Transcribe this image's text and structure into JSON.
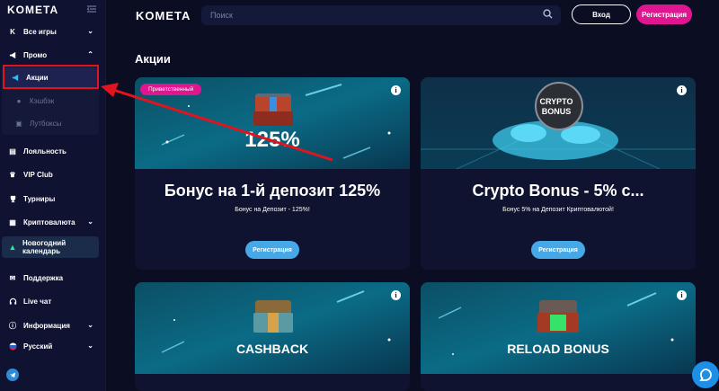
{
  "brand": {
    "logo": "KOMETA"
  },
  "sidebar": {
    "items": [
      {
        "label": "Все игры",
        "icon": "kometa-icon"
      },
      {
        "label": "Промо",
        "icon": "megaphone-icon"
      },
      {
        "label": "Лояльность",
        "icon": "loyalty-icon"
      },
      {
        "label": "VIP Club",
        "icon": "crown-icon"
      },
      {
        "label": "Турниры",
        "icon": "trophy-icon"
      },
      {
        "label": "Криптовалюта",
        "icon": "crypto-icon"
      },
      {
        "label": "Новогодний календарь",
        "icon": "tree-icon"
      },
      {
        "label": "Поддержка",
        "icon": "support-icon"
      },
      {
        "label": "Live чат",
        "icon": "headset-icon"
      },
      {
        "label": "Информация",
        "icon": "info-icon"
      },
      {
        "label": "Русский",
        "icon": "russia-flag-icon"
      }
    ],
    "promo_sub": [
      {
        "label": "Акции",
        "active": true
      },
      {
        "label": "Кэшбэк",
        "active": false
      },
      {
        "label": "Лутбоксы",
        "active": false
      }
    ],
    "calendar_line1": "Новогодний",
    "calendar_line2": "календарь"
  },
  "header": {
    "search_placeholder": "Поиск",
    "login_label": "Вход",
    "register_label": "Регистрация"
  },
  "main": {
    "title": "Акции",
    "cards": [
      {
        "badge": "Приветственный",
        "image_text": "125%",
        "title": "Бонус на 1-й депозит 125%",
        "subtitle": "Бонус на Депозит - 125%!",
        "button": "Регистрация"
      },
      {
        "image_text_line1": "CRYPTO",
        "image_text_line2": "BONUS",
        "title": "Crypto Bonus - 5% c...",
        "subtitle": "Бонус 5% на Депозит Криптовалютой!",
        "button": "Регистрация"
      },
      {
        "image_text": "CASHBACK"
      },
      {
        "image_text": "RELOAD BONUS"
      }
    ]
  },
  "colors": {
    "accent_pink": "#e0158f",
    "accent_blue": "#46a8e6",
    "annotation_red": "#e0141f"
  }
}
